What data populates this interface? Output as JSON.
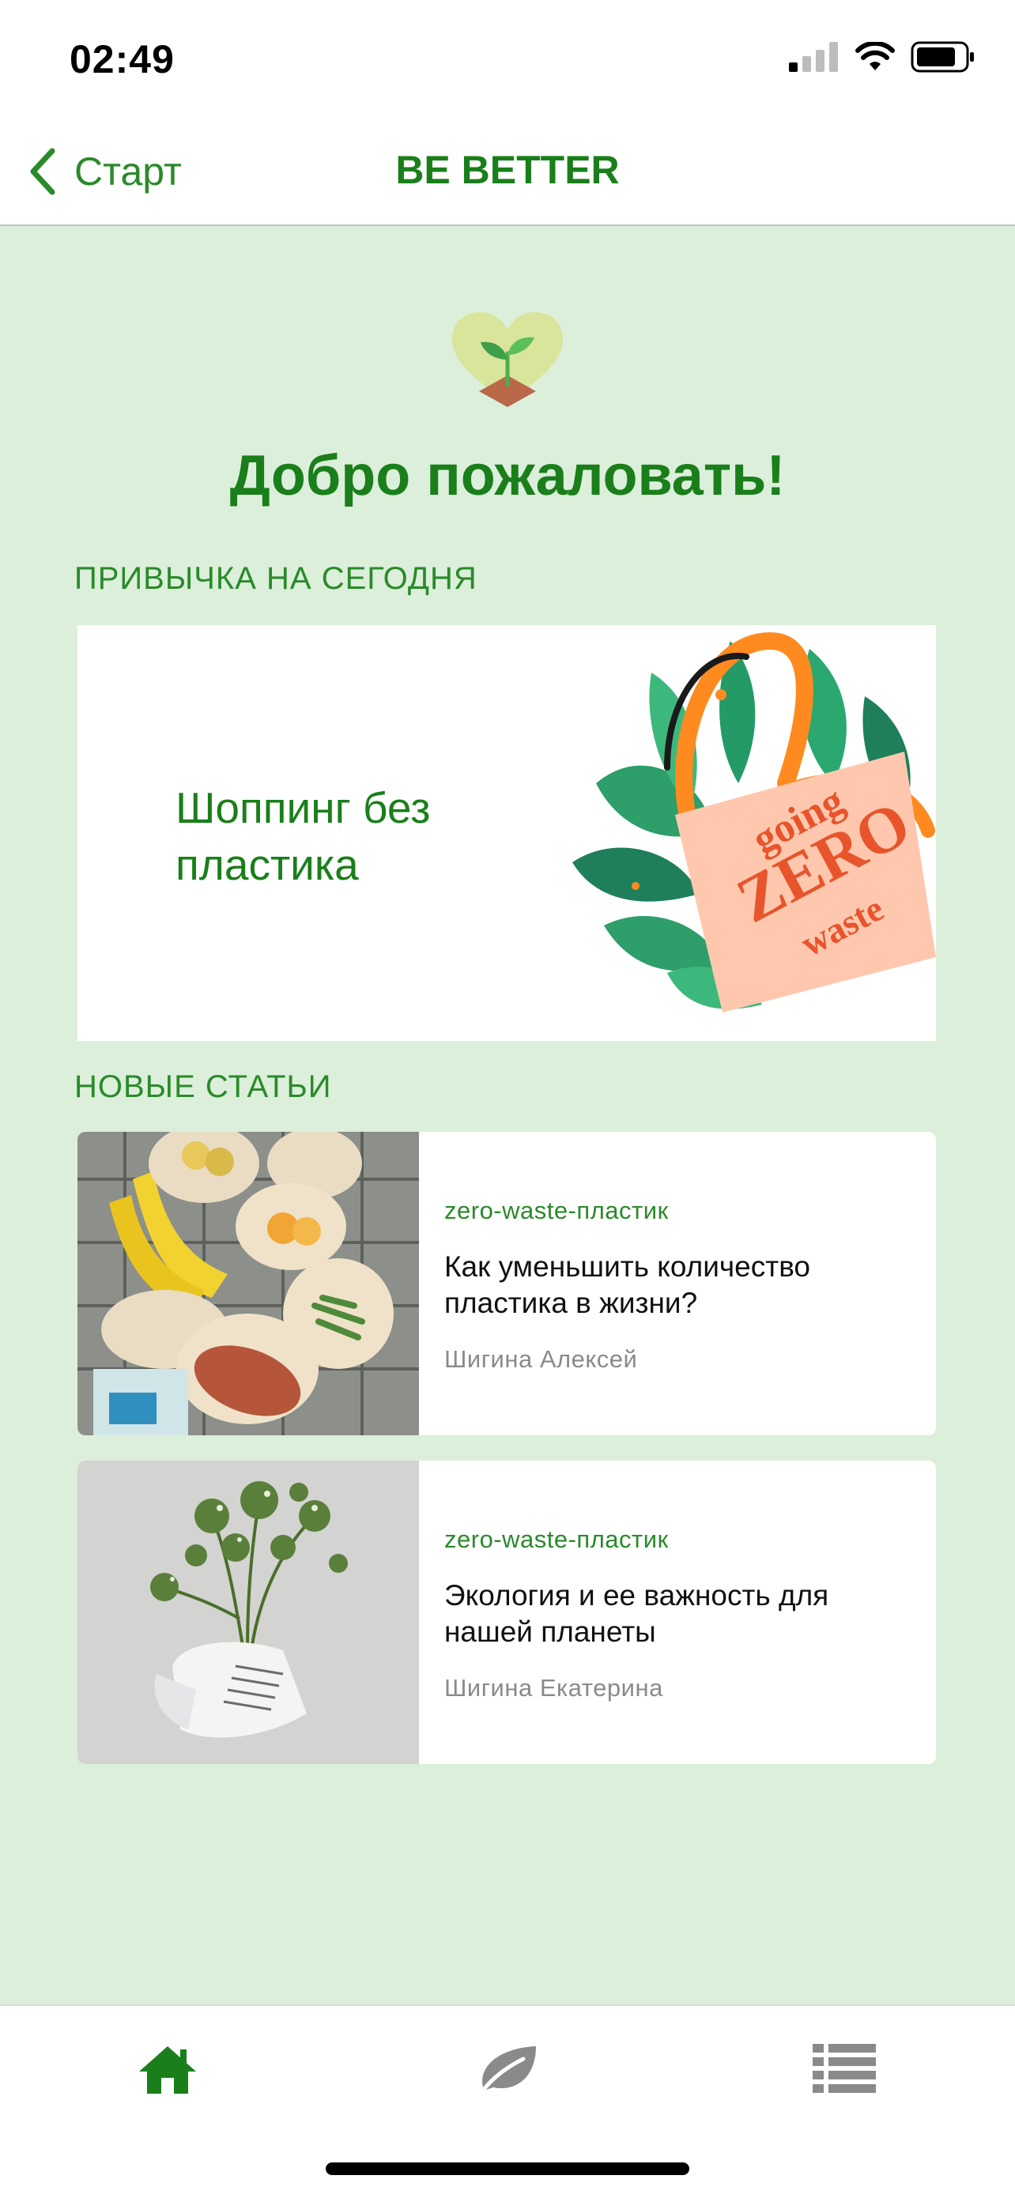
{
  "status_bar": {
    "time": "02:49"
  },
  "nav": {
    "back_label": "Старт",
    "title": "BE BETTER"
  },
  "main": {
    "welcome": "Добро пожаловать!",
    "habit_section_title": "ПРИВЫЧКА НА СЕГОДНЯ",
    "habit": {
      "title": "Шоппинг без пластика",
      "art_text": {
        "line1": "going",
        "line2": "ZERO",
        "line3": "waste"
      }
    },
    "articles_section_title": "НОВЫЕ СТАТЬИ",
    "articles": [
      {
        "tag": "zero-waste-пластик",
        "title": "Как уменьшить количество пластика в жизни?",
        "author": "Шигина Алексей"
      },
      {
        "tag": "zero-waste-пластик",
        "title": "Экология и ее важность для нашей планеты",
        "author": "Шигина Екатерина"
      }
    ]
  },
  "tab_bar": {
    "tabs": [
      {
        "icon": "home-icon",
        "active": true
      },
      {
        "icon": "leaf-icon",
        "active": false
      },
      {
        "icon": "list-icon",
        "active": false
      }
    ]
  },
  "colors": {
    "accent": "#1a7f1a",
    "background": "#dcefdb",
    "inactive_icon": "#8a8a8a"
  }
}
